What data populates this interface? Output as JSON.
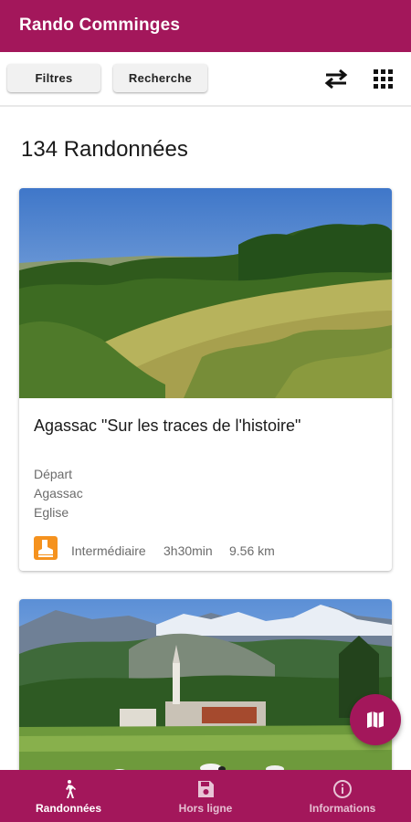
{
  "app": {
    "title": "Rando Comminges"
  },
  "toolbar": {
    "filters_label": "Filtres",
    "search_label": "Recherche",
    "swap_icon": "swap-arrows-icon",
    "grid_icon": "grid-view-icon"
  },
  "list": {
    "count_label": "134 Randonnées",
    "cards": [
      {
        "title": "Agassac \"Sur les traces de l'histoire\"",
        "departure_lines": [
          "Départ",
          "Agassac",
          "Eglise"
        ],
        "difficulty": "Intermédiaire",
        "duration": "3h30min",
        "distance": "9.56 km",
        "difficulty_icon": "hiking-boot-icon",
        "difficulty_color": "#f5921e"
      },
      {
        "photo": "village-mountains-photo"
      }
    ]
  },
  "fab": {
    "icon": "map-icon"
  },
  "bottom_nav": {
    "items": [
      {
        "label": "Randonnées",
        "icon": "hiker-icon",
        "active": true
      },
      {
        "label": "Hors ligne",
        "icon": "save-icon",
        "active": false
      },
      {
        "label": "Informations",
        "icon": "info-icon",
        "active": false
      }
    ]
  },
  "colors": {
    "primary": "#a3175b",
    "difficulty_orange": "#f5921e"
  }
}
